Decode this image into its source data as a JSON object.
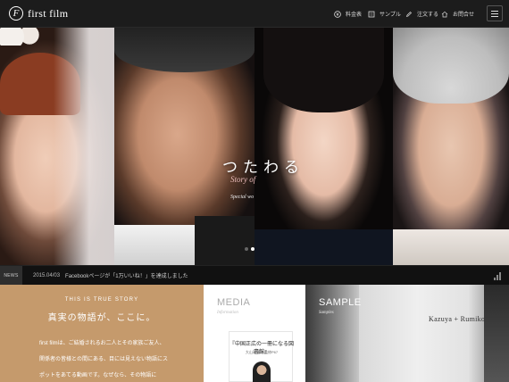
{
  "header": {
    "logo_mark": "F",
    "logo_text": "first film",
    "nav": [
      {
        "label": "料金表",
        "icon": "yen-icon"
      },
      {
        "label": "サンプル",
        "icon": "film-icon"
      },
      {
        "label": "注文する",
        "icon": "pencil-icon"
      },
      {
        "label": "お問合せ",
        "icon": "house-icon"
      }
    ],
    "menu_icon": "hamburger-icon"
  },
  "hero": {
    "title": "つたわる",
    "subtitle": "Story of",
    "subtitle2": "Special wo",
    "slide_count": 2,
    "active_slide": 2
  },
  "news": {
    "label": "NEWS",
    "date": "2015.04/03",
    "text": "Facebookページが「1万いいね！」を達成しました"
  },
  "story": {
    "kicker": "THIS IS TRUE STORY",
    "title": "真実の物語が、ここに。",
    "lines": [
      "first filmは、ご結婚されるお二人とその家族ご友人、",
      "関係者の皆様との間にある、目には見えない物語にス",
      "ポットをあてる動画です。なぜなら、その物語に"
    ]
  },
  "media": {
    "title": "MEDIA",
    "subtitle": "Information",
    "book_title": "『中国正広の一冊になる図書館』",
    "book_author": "大山高 著者監修P67"
  },
  "sample": {
    "title": "SAMPLE",
    "subtitle": "Samples",
    "names": "Kazuya + Rumiko"
  },
  "colors": {
    "header_bg": "#1c1c1c",
    "story_bg": "#c59a6c",
    "accent_pink": "#e7b8b8"
  }
}
